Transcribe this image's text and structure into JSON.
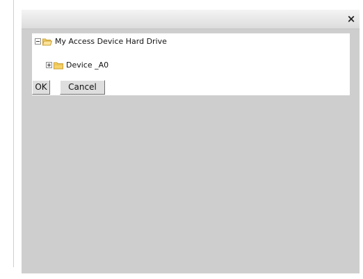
{
  "dialog": {
    "close_glyph": "×"
  },
  "tree": {
    "root": {
      "label": "My Access Device Hard Drive",
      "expander_icon": "collapse-minus",
      "folder_icon": "open-folder"
    },
    "child": {
      "label": "Device _A0",
      "expander_icon": "expand-plus",
      "folder_icon": "closed-folder"
    }
  },
  "buttons": {
    "ok_label": "OK",
    "cancel_label": "Cancel"
  },
  "colors": {
    "dialog_bg": "#cecece",
    "panel_bg": "#ffffff",
    "folder_fill": "#f6d26a",
    "folder_stroke": "#c9a033"
  }
}
